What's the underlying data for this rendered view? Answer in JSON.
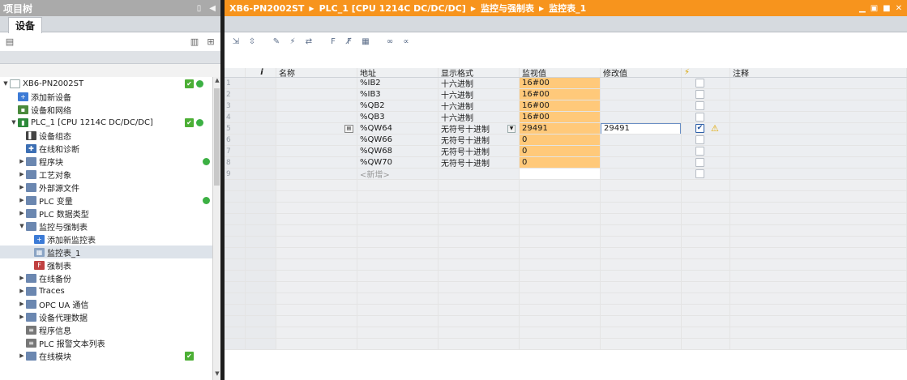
{
  "left_panel": {
    "title": "项目树",
    "tab_label": "设备",
    "tree": [
      {
        "label": "XB6-PN2002ST",
        "indent": 0,
        "toggle": "▼",
        "icon": "device-icon",
        "icon_glyph": "",
        "icon_class": "dev",
        "check": "✔",
        "dot": true,
        "selected": false
      },
      {
        "label": "添加新设备",
        "indent": 1,
        "toggle": "",
        "icon": "add-device-icon",
        "icon_glyph": "+",
        "icon_class": "add",
        "check": "",
        "dot": false,
        "selected": false
      },
      {
        "label": "设备和网络",
        "indent": 1,
        "toggle": "",
        "icon": "network-icon",
        "icon_glyph": "▪",
        "icon_class": "net",
        "check": "",
        "dot": false,
        "selected": false
      },
      {
        "label": "PLC_1 [CPU 1214C DC/DC/DC]",
        "indent": 1,
        "toggle": "▼",
        "icon": "plc-icon",
        "icon_glyph": "▮",
        "icon_class": "plc",
        "check": "✔",
        "dot": true,
        "selected": false
      },
      {
        "label": "设备组态",
        "indent": 2,
        "toggle": "",
        "icon": "device-config-icon",
        "icon_glyph": "▌",
        "icon_class": "cfg",
        "check": "",
        "dot": false,
        "selected": false
      },
      {
        "label": "在线和诊断",
        "indent": 2,
        "toggle": "",
        "icon": "diagnostics-icon",
        "icon_glyph": "✚",
        "icon_class": "diag",
        "check": "",
        "dot": false,
        "selected": false
      },
      {
        "label": "程序块",
        "indent": 2,
        "toggle": "▶",
        "icon": "folder-icon",
        "icon_glyph": "",
        "icon_class": "fold",
        "check": "",
        "dot": true,
        "selected": false
      },
      {
        "label": "工艺对象",
        "indent": 2,
        "toggle": "▶",
        "icon": "folder-icon",
        "icon_glyph": "",
        "icon_class": "fold",
        "check": "",
        "dot": false,
        "selected": false
      },
      {
        "label": "外部源文件",
        "indent": 2,
        "toggle": "▶",
        "icon": "folder-icon",
        "icon_glyph": "",
        "icon_class": "fold",
        "check": "",
        "dot": false,
        "selected": false
      },
      {
        "label": "PLC 变量",
        "indent": 2,
        "toggle": "▶",
        "icon": "folder-icon",
        "icon_glyph": "",
        "icon_class": "fold",
        "check": "",
        "dot": true,
        "selected": false
      },
      {
        "label": "PLC 数据类型",
        "indent": 2,
        "toggle": "▶",
        "icon": "folder-icon",
        "icon_glyph": "",
        "icon_class": "fold",
        "check": "",
        "dot": false,
        "selected": false
      },
      {
        "label": "监控与强制表",
        "indent": 2,
        "toggle": "▼",
        "icon": "folder-icon",
        "icon_glyph": "",
        "icon_class": "fold",
        "check": "",
        "dot": false,
        "selected": false
      },
      {
        "label": "添加新监控表",
        "indent": 3,
        "toggle": "",
        "icon": "add-table-icon",
        "icon_glyph": "+",
        "icon_class": "add",
        "check": "",
        "dot": false,
        "selected": false
      },
      {
        "label": "监控表_1",
        "indent": 3,
        "toggle": "",
        "icon": "watch-table-icon",
        "icon_glyph": "▦",
        "icon_class": "tbl",
        "check": "",
        "dot": false,
        "selected": true
      },
      {
        "label": "强制表",
        "indent": 3,
        "toggle": "",
        "icon": "force-table-icon",
        "icon_glyph": "F",
        "icon_class": "force",
        "check": "",
        "dot": false,
        "selected": false
      },
      {
        "label": "在线备份",
        "indent": 2,
        "toggle": "▶",
        "icon": "folder-icon",
        "icon_glyph": "",
        "icon_class": "fold",
        "check": "",
        "dot": false,
        "selected": false
      },
      {
        "label": "Traces",
        "indent": 2,
        "toggle": "▶",
        "icon": "folder-icon",
        "icon_glyph": "",
        "icon_class": "fold",
        "check": "",
        "dot": false,
        "selected": false
      },
      {
        "label": "OPC UA 通信",
        "indent": 2,
        "toggle": "▶",
        "icon": "folder-icon",
        "icon_glyph": "",
        "icon_class": "fold",
        "check": "",
        "dot": false,
        "selected": false
      },
      {
        "label": "设备代理数据",
        "indent": 2,
        "toggle": "▶",
        "icon": "folder-icon",
        "icon_glyph": "",
        "icon_class": "fold",
        "check": "",
        "dot": false,
        "selected": false
      },
      {
        "label": "程序信息",
        "indent": 2,
        "toggle": "",
        "icon": "program-info-icon",
        "icon_glyph": "≡",
        "icon_class": "doc",
        "check": "",
        "dot": false,
        "selected": false
      },
      {
        "label": "PLC 报警文本列表",
        "indent": 2,
        "toggle": "",
        "icon": "alarm-text-icon",
        "icon_glyph": "≡",
        "icon_class": "doc",
        "check": "",
        "dot": false,
        "selected": false
      },
      {
        "label": "在线模块",
        "indent": 2,
        "toggle": "▶",
        "icon": "folder-icon",
        "icon_glyph": "",
        "icon_class": "fold",
        "check": "✔",
        "dot": false,
        "selected": false
      }
    ]
  },
  "right_panel": {
    "breadcrumb": [
      "XB6-PN2002ST",
      "PLC_1 [CPU 1214C DC/DC/DC]",
      "监控与强制表",
      "监控表_1"
    ],
    "columns": {
      "info": "i",
      "name": "名称",
      "address": "地址",
      "format": "显示格式",
      "monitor": "监视值",
      "modify": "修改值",
      "comment": "注释"
    },
    "rows": [
      {
        "n": "1",
        "name": "",
        "address": "%IB2",
        "format": "十六进制",
        "monitor": "16#00",
        "modify": "",
        "checked": false,
        "warn": false
      },
      {
        "n": "2",
        "name": "",
        "address": "%IB3",
        "format": "十六进制",
        "monitor": "16#00",
        "modify": "",
        "checked": false,
        "warn": false
      },
      {
        "n": "3",
        "name": "",
        "address": "%QB2",
        "format": "十六进制",
        "monitor": "16#00",
        "modify": "",
        "checked": false,
        "warn": false
      },
      {
        "n": "4",
        "name": "",
        "address": "%QB3",
        "format": "十六进制",
        "monitor": "16#00",
        "modify": "",
        "checked": false,
        "warn": false
      },
      {
        "n": "5",
        "name": "",
        "address": "%QW64",
        "format": "无符号十进制",
        "monitor": "29491",
        "modify": "29491",
        "checked": true,
        "warn": true
      },
      {
        "n": "6",
        "name": "",
        "address": "%QW66",
        "format": "无符号十进制",
        "monitor": "0",
        "modify": "",
        "checked": false,
        "warn": false
      },
      {
        "n": "7",
        "name": "",
        "address": "%QW68",
        "format": "无符号十进制",
        "monitor": "0",
        "modify": "",
        "checked": false,
        "warn": false
      },
      {
        "n": "8",
        "name": "",
        "address": "%QW70",
        "format": "无符号十进制",
        "monitor": "0",
        "modify": "",
        "checked": false,
        "warn": false
      },
      {
        "n": "9",
        "name": "",
        "address": "<新增>",
        "format": "",
        "monitor": "",
        "modify": "",
        "checked": false,
        "warn": false,
        "is_new": true
      }
    ],
    "empty_rows": 15
  },
  "colors": {
    "title_orange": "#f7941d",
    "monitor_fill": "#ffc97a",
    "status_green": "#3cb043"
  }
}
